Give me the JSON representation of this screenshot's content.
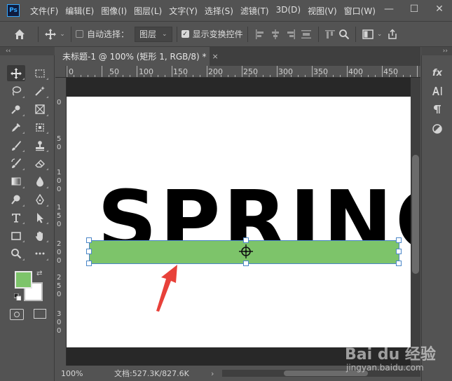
{
  "app": {
    "logo": "Ps"
  },
  "menu": [
    "文件(F)",
    "编辑(E)",
    "图像(I)",
    "图层(L)",
    "文字(Y)",
    "选择(S)",
    "滤镜(T)",
    "3D(D)",
    "视图(V)",
    "窗口(W)"
  ],
  "window_controls": {
    "minimize": "—",
    "maximize": "☐",
    "close": "✕"
  },
  "options": {
    "auto_select_label": "自动选择：",
    "auto_select_checked": false,
    "target_select": "图层",
    "show_transform_label": "显示变换控件",
    "show_transform_checked": true
  },
  "collapse_left": "‹‹",
  "collapse_right": "››",
  "document": {
    "tab_title": "未标题-1 @ 100% (矩形 1, RGB/8) *",
    "tab_close": "×",
    "text_layer": "SPRING"
  },
  "ruler": {
    "h_labels": [
      "0",
      "50",
      "100",
      "150",
      "200",
      "250",
      "300",
      "350",
      "400",
      "450"
    ],
    "v_labels": [
      "0",
      "5",
      "0",
      "1",
      "0",
      "0",
      "1",
      "5",
      "0",
      "2",
      "0",
      "0",
      "2",
      "5",
      "0",
      "3",
      "0",
      "0"
    ]
  },
  "colors": {
    "foreground": "#7dc46a",
    "background": "#ffffff",
    "accent": "#31a8ff",
    "rect_fill": "#7dc46a",
    "arrow": "#e8413a"
  },
  "status": {
    "zoom": "100%",
    "doc_size": "文档:527.3K/827.6K",
    "chev": "›"
  },
  "watermark": {
    "logo": "Bai du 经验",
    "sub": "jingyan.baidu.com"
  }
}
